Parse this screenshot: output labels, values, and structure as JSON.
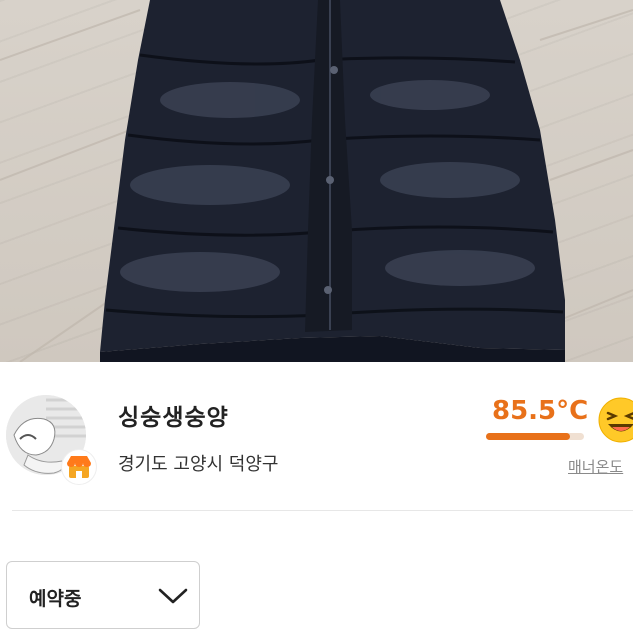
{
  "seller": {
    "name": "싱숭생숭양",
    "region": "경기도 고양시 덕양구"
  },
  "manner": {
    "temperature": "85.5°C",
    "temperature_value": 85.5,
    "bar_fill_percent": 85.5,
    "link_label": "매너온도"
  },
  "status_select": {
    "selected": "예약중"
  },
  "colors": {
    "accent": "#e8711a",
    "jacket": "#1d2230",
    "floor": "#d6cfc6"
  },
  "icons": {
    "shop_badge": "shop-icon",
    "face": "laughing-face-icon",
    "chevron": "chevron-down-icon"
  }
}
